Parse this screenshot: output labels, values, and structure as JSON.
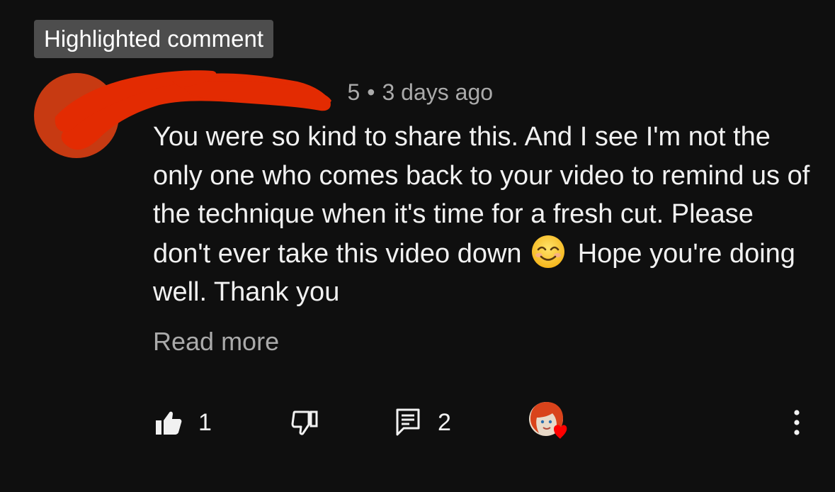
{
  "badge": {
    "label": "Highlighted comment"
  },
  "comment": {
    "handle_visible": "@",
    "handle_suffix_visible": "5",
    "separator": "•",
    "timestamp": "3 days ago",
    "text_before_emoji": "You were so kind to share this. And I see I'm not the only one who comes back to your video to remind us of the technique when it's time for a fresh cut. Please don't ever take this video down",
    "emoji": "smiling-face-with-smiling-eyes",
    "text_after_emoji": " Hope you're doing well. Thank you",
    "read_more_label": "Read more"
  },
  "actions": {
    "like_count": "1",
    "reply_count": "2",
    "icons": [
      "thumbs-up-icon",
      "thumbs-down-icon",
      "reply-icon",
      "creator-heart-icon",
      "more-vertical-icon"
    ]
  },
  "colors": {
    "background": "#0f0f0f",
    "badge_bg": "#4d4d4d",
    "text_primary": "#f1f1f1",
    "text_secondary": "#aaaaaa",
    "avatar": "#c73a12",
    "redaction": "#e32b02",
    "heart": "#ff0000"
  }
}
